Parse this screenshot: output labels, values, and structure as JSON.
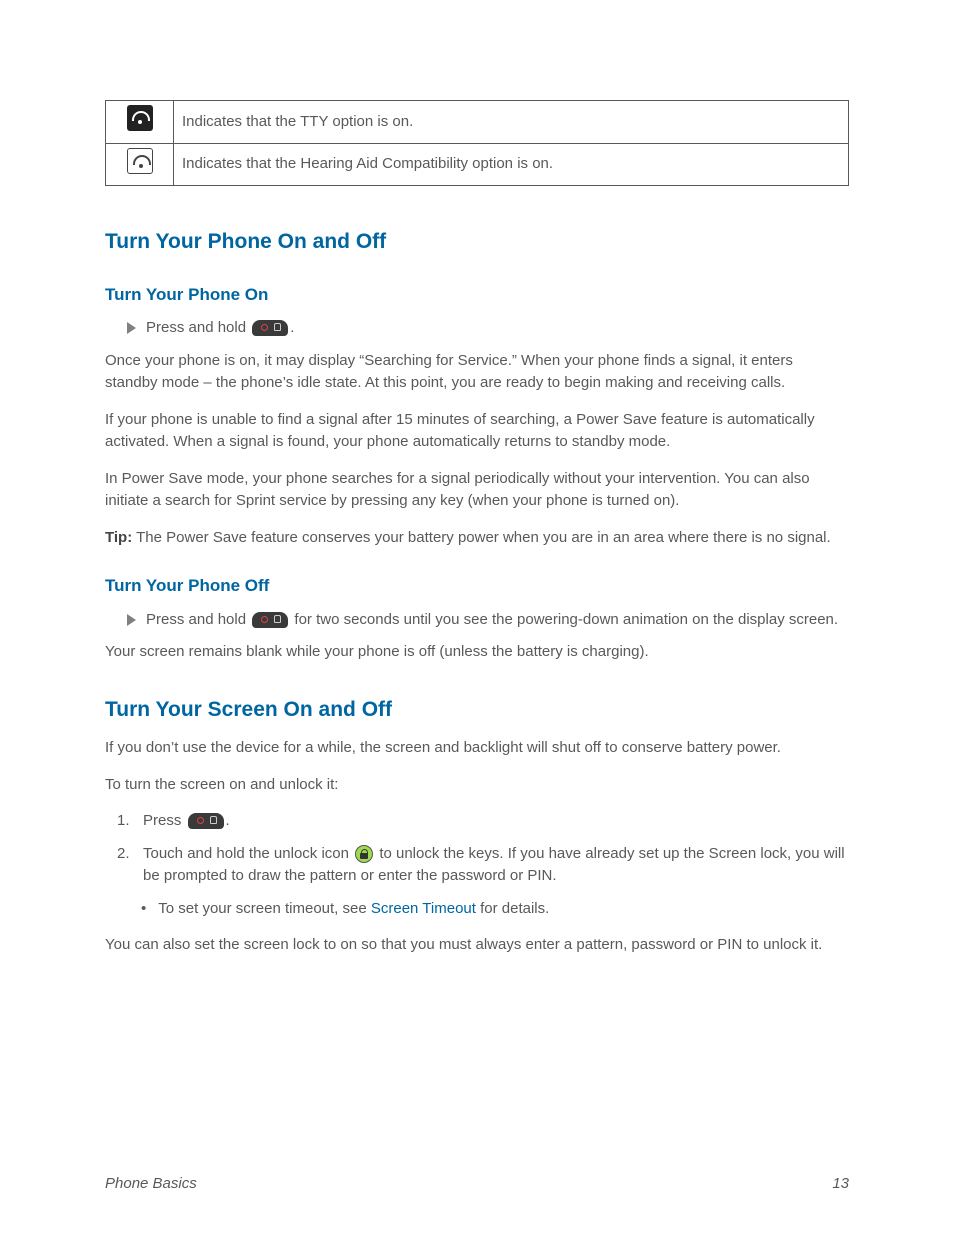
{
  "table": {
    "row1": "Indicates that the TTY option is on.",
    "row2": "Indicates that the Hearing Aid Compatibility option is on."
  },
  "onoff": {
    "heading": "Turn Your Phone On and Off",
    "on_heading": "Turn Your Phone On",
    "on_step": "Press and hold",
    "on_step_after": ".",
    "on_p1_a": "Once your phone is on, it may display “Searching",
    "on_p1_b": " for Service",
    "on_p1_c": ".” When your phone finds a signal,",
    "on_p2_a": " it enters standby mode ",
    "on_p2_b": "– the phone’s idle state. At this",
    "on_p2_c": " point, you are ready to begin making and receiving calls.",
    "on_p3": "If your phone is unable to find a signal after 15 minutes of searching, a Power Save feature is automatically activated. When a signal is found, your phone automatically returns to standby mode.",
    "on_p4": "In Power Save mode, your phone searches for a signal periodically without your intervention. You can also initiate a search for Sprint service by pressing any key (when your phone is turned on).",
    "tip_label": "Tip:",
    "tip_text": "The Power Save feature conserves your battery power when you are in an area where there is no signal.",
    "off_heading": "Turn Your Phone Off",
    "off_step_before": "Press and hold ",
    "off_step_after": " for two seconds until you see the powering-down animation on the display screen.",
    "off_p": "Your screen remains blank while your phone is off (unless the battery is charging)."
  },
  "screen": {
    "heading": "Turn Your Screen On and Off",
    "p1_a": "If you don’t use the device for a while, the screen",
    "p1_b": " and backlight will shut off to conserve battery power.",
    "p2": "To turn the screen on and unlock it:",
    "step1_before": "Press ",
    "step1_after": ".",
    "step2_before": "Touch and hold the unlock icon ",
    "step2_after": " to unlock the keys. If you have already set up the Screen lock, you will be prompted to draw the pattern or enter the password or PIN.",
    "p3_before": "To set your screen timeout, see ",
    "p3_link": "Screen Timeout",
    "p3_after": " for details.",
    "p4": "You can also set the screen lock to on so that you must always enter a pattern, password or PIN to unlock it."
  },
  "footer": {
    "left": "Phone Basics",
    "right": "13"
  }
}
